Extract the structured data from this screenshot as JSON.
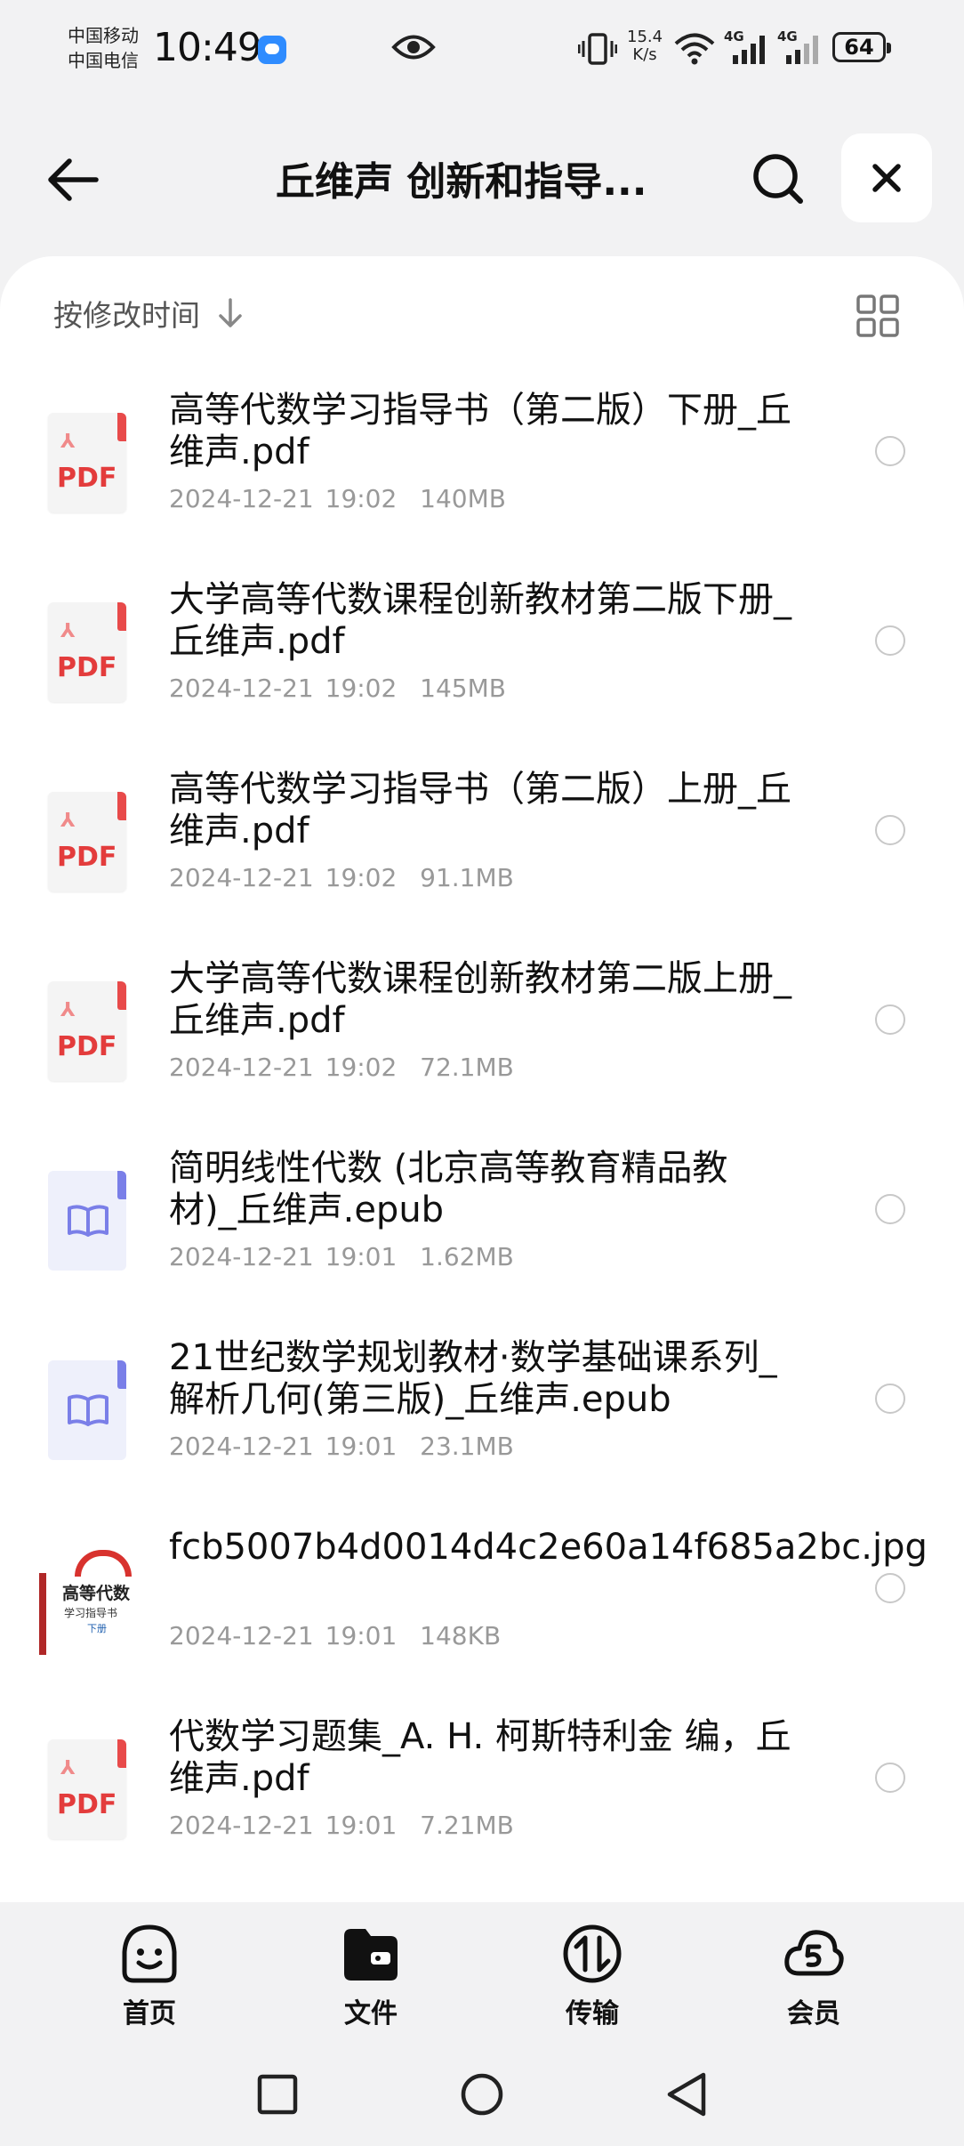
{
  "status_bar": {
    "carrier_1": "中国移动",
    "carrier_2": "中国电信",
    "time": "10:49",
    "speed_value": "15.4",
    "speed_unit": "K/s",
    "network_1": "4G",
    "network_2": "4G",
    "battery": "64"
  },
  "header": {
    "title": "丘维声 创新和指导..."
  },
  "toolbar": {
    "sort_label": "按修改时间"
  },
  "files": [
    {
      "type": "pdf",
      "icon": "pdf-icon",
      "name": "高等代数学习指导书（第二版）下册_丘维声.pdf",
      "date": "2024-12-21 19:02",
      "size": "140MB"
    },
    {
      "type": "pdf",
      "icon": "pdf-icon",
      "name": "大学高等代数课程创新教材第二版下册_丘维声.pdf",
      "date": "2024-12-21 19:02",
      "size": "145MB"
    },
    {
      "type": "pdf",
      "icon": "pdf-icon",
      "name": "高等代数学习指导书（第二版）上册_丘维声.pdf",
      "date": "2024-12-21 19:02",
      "size": "91.1MB"
    },
    {
      "type": "pdf",
      "icon": "pdf-icon",
      "name": "大学高等代数课程创新教材第二版上册_丘维声.pdf",
      "date": "2024-12-21 19:02",
      "size": "72.1MB"
    },
    {
      "type": "epub",
      "icon": "book-icon",
      "name": "简明线性代数 (北京高等教育精品教材)_丘维声.epub",
      "date": "2024-12-21 19:01",
      "size": "1.62MB"
    },
    {
      "type": "epub",
      "icon": "book-icon",
      "name": "21世纪数学规划教材·数学基础课系列_解析几何(第三版)_丘维声.epub",
      "date": "2024-12-21 19:01",
      "size": "23.1MB"
    },
    {
      "type": "jpg",
      "icon": "image-thumbnail",
      "name": "fcb5007b4d0014d4c2e60a14f685a2bc.jpg",
      "date": "2024-12-21 19:01",
      "size": "148KB",
      "thumb_title": "高等代数",
      "thumb_subtitle": "学习指导书",
      "thumb_volume": "下册"
    },
    {
      "type": "pdf",
      "icon": "pdf-icon",
      "name": "代数学习题集_A. H. 柯斯特利金 编，丘维声.pdf",
      "date": "2024-12-21 19:01",
      "size": "7.21MB"
    }
  ],
  "file_icon_labels": {
    "pdf": "PDF"
  },
  "bottom_nav": [
    {
      "label": "首页",
      "icon": "smiley-home-icon"
    },
    {
      "label": "文件",
      "icon": "folder-icon"
    },
    {
      "label": "传输",
      "icon": "transfer-icon"
    },
    {
      "label": "会员",
      "icon": "vip-cloud-icon"
    }
  ],
  "colors": {
    "background": "#f2f2f3",
    "card": "#ffffff",
    "pdf_red": "#e33c3c",
    "epub_purple": "#7a7fe8",
    "meta_gray": "#999999"
  }
}
